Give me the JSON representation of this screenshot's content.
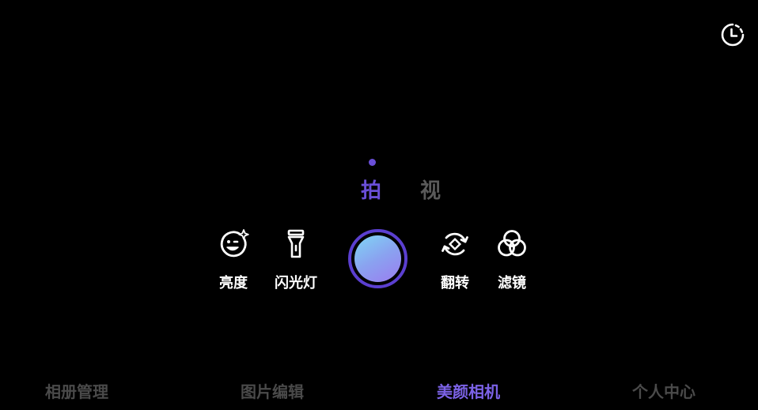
{
  "colors": {
    "background": "#000000",
    "accent": "#6a4fd8",
    "inactive": "#4a4a4a",
    "text": "#ffffff"
  },
  "top_bar": {
    "timer_icon": "clock-timer-icon"
  },
  "modes": {
    "photo": "拍",
    "video": "视",
    "active": "photo"
  },
  "tools": {
    "brightness": {
      "label": "亮度",
      "icon": "face-sparkle-icon"
    },
    "flash": {
      "label": "闪光灯",
      "icon": "flashlight-icon"
    },
    "flip": {
      "label": "翻转",
      "icon": "flip-camera-icon"
    },
    "filter": {
      "label": "滤镜",
      "icon": "filter-circles-icon"
    }
  },
  "shutter": {
    "icon": "shutter-button"
  },
  "bottom_nav": {
    "items": [
      {
        "label": "相册管理",
        "active": false
      },
      {
        "label": "图片编辑",
        "active": false
      },
      {
        "label": "美颜相机",
        "active": true
      },
      {
        "label": "个人中心",
        "active": false
      }
    ]
  }
}
